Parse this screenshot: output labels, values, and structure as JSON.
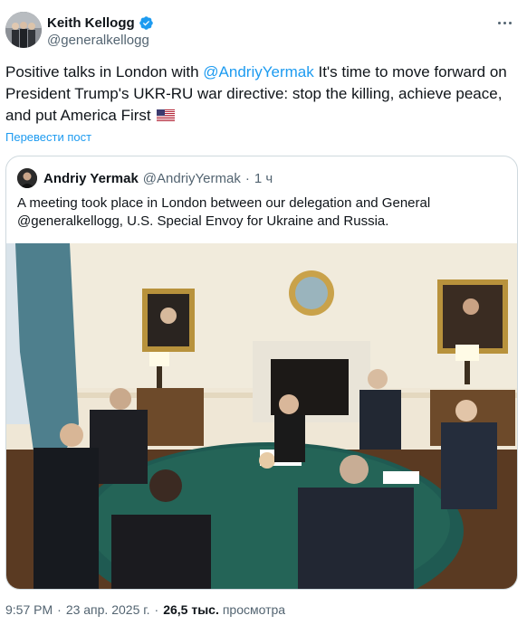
{
  "author": {
    "name": "Keith Kellogg",
    "handle": "@generalkellogg",
    "verified_color": "#1d9bf0"
  },
  "more_icon": "ellipsis-icon",
  "tweet": {
    "text_before": "Positive talks in London with ",
    "mention": "@AndriyYermak",
    "text_after": " It's time to move forward on President Trump's UKR-RU war directive: stop the killing, achieve peace, and put America First",
    "emoji": "us-flag-icon",
    "translate_label": "Перевести пост"
  },
  "quoted": {
    "name": "Andriy Yermak",
    "handle": "@AndriyYermak",
    "separator": "·",
    "time": "1 ч",
    "text": "A meeting took place in London between our delegation and General @generalkellogg, U.S. Special Envoy for Ukraine and Russia."
  },
  "meta": {
    "time": "9:57 PM",
    "separator": "·",
    "date": "23 апр. 2025 г.",
    "separator2": "·",
    "views_count": "26,5 тыс.",
    "views_label": "просмотра"
  },
  "colors": {
    "accent": "#1d9bf0",
    "secondary_text": "#536471",
    "border": "#cfd9de"
  }
}
